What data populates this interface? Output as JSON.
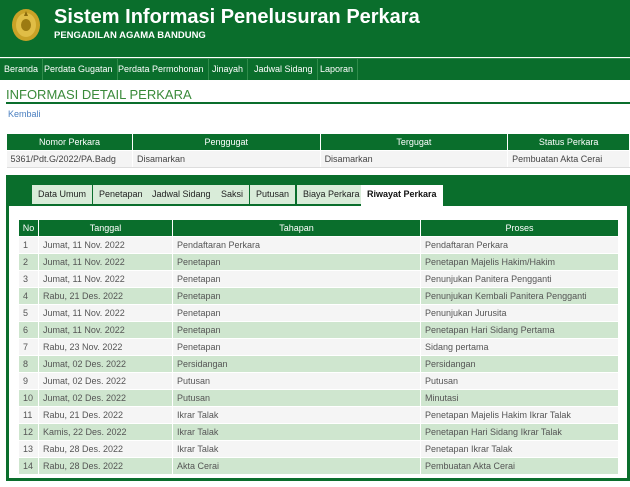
{
  "header": {
    "title": "Sistem Informasi Penelusuran Perkara",
    "subtitle": "PENGADILAN AGAMA BANDUNG"
  },
  "nav": [
    "Beranda",
    "Perdata Gugatan",
    "Perdata Permohonan",
    "Jinayah",
    "Jadwal Sidang",
    "Laporan"
  ],
  "page_title": "INFORMASI DETAIL PERKARA",
  "back_label": "Kembali",
  "summary": {
    "headers": [
      "Nomor Perkara",
      "Penggugat",
      "Tergugat",
      "Status Perkara"
    ],
    "row": [
      "5361/Pdt.G/2022/PA.Badg",
      "Disamarkan",
      "Disamarkan",
      "Pembuatan Akta Cerai"
    ]
  },
  "tabs": [
    "Data Umum",
    "Penetapan",
    "Jadwal Sidang",
    "Saksi",
    "Putusan",
    "Biaya Perkara",
    "Riwayat Perkara"
  ],
  "active_tab": "Riwayat Perkara",
  "history": {
    "headers": [
      "No",
      "Tanggal",
      "Tahapan",
      "Proses"
    ],
    "rows": [
      [
        "1",
        "Jumat, 11 Nov. 2022",
        "Pendaftaran Perkara",
        "Pendaftaran Perkara"
      ],
      [
        "2",
        "Jumat, 11 Nov. 2022",
        "Penetapan",
        "Penetapan Majelis Hakim/Hakim"
      ],
      [
        "3",
        "Jumat, 11 Nov. 2022",
        "Penetapan",
        "Penunjukan Panitera Pengganti"
      ],
      [
        "4",
        "Rabu, 21 Des. 2022",
        "Penetapan",
        "Penunjukan Kembali Panitera Pengganti"
      ],
      [
        "5",
        "Jumat, 11 Nov. 2022",
        "Penetapan",
        "Penunjukan Jurusita"
      ],
      [
        "6",
        "Jumat, 11 Nov. 2022",
        "Penetapan",
        "Penetapan Hari Sidang Pertama"
      ],
      [
        "7",
        "Rabu, 23 Nov. 2022",
        "Penetapan",
        "Sidang pertama"
      ],
      [
        "8",
        "Jumat, 02 Des. 2022",
        "Persidangan",
        "Persidangan"
      ],
      [
        "9",
        "Jumat, 02 Des. 2022",
        "Putusan",
        "Putusan"
      ],
      [
        "10",
        "Jumat, 02 Des. 2022",
        "Putusan",
        "Minutasi"
      ],
      [
        "11",
        "Rabu, 21 Des. 2022",
        "Ikrar Talak",
        "Penetapan Majelis Hakim Ikrar Talak"
      ],
      [
        "12",
        "Kamis, 22 Des. 2022",
        "Ikrar Talak",
        "Penetapan Hari Sidang Ikrar Talak"
      ],
      [
        "13",
        "Rabu, 28 Des. 2022",
        "Ikrar Talak",
        "Penetapan Ikrar Talak"
      ],
      [
        "14",
        "Rabu, 28 Des. 2022",
        "Akta Cerai",
        "Pembuatan Akta Cerai"
      ]
    ]
  },
  "colors": {
    "brand_green": "#0a6e2c",
    "row_green": "#cfe6cf",
    "title_green": "#3a8a3a",
    "link_blue": "#4a7fc0"
  }
}
